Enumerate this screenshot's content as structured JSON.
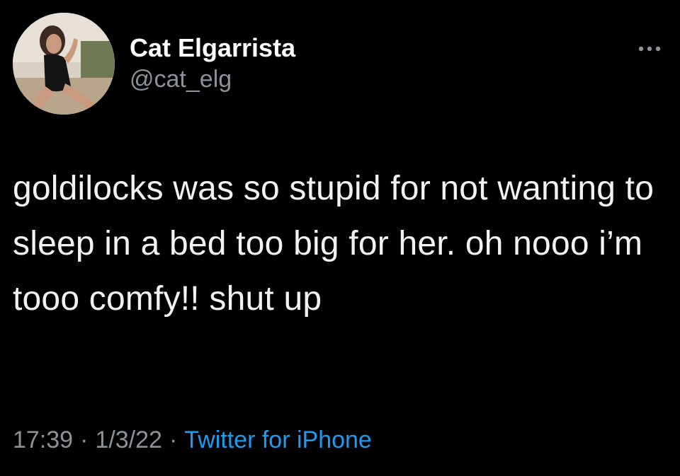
{
  "tweet": {
    "author": {
      "display_name": "Cat Elgarrista",
      "handle": "@cat_elg"
    },
    "text": "goldilocks was so stupid for not wanting to sleep in a bed too big for her. oh nooo i’m tooo comfy!! shut up",
    "time": "17:39",
    "separator": "·",
    "date": "1/3/22",
    "source": "Twitter for iPhone"
  },
  "icons": {
    "more": "more-options-icon",
    "avatar": "profile-photo"
  },
  "colors": {
    "background": "#000000",
    "text": "#f2f2f2",
    "secondary": "#8b9298",
    "link": "#1d9bf0"
  }
}
